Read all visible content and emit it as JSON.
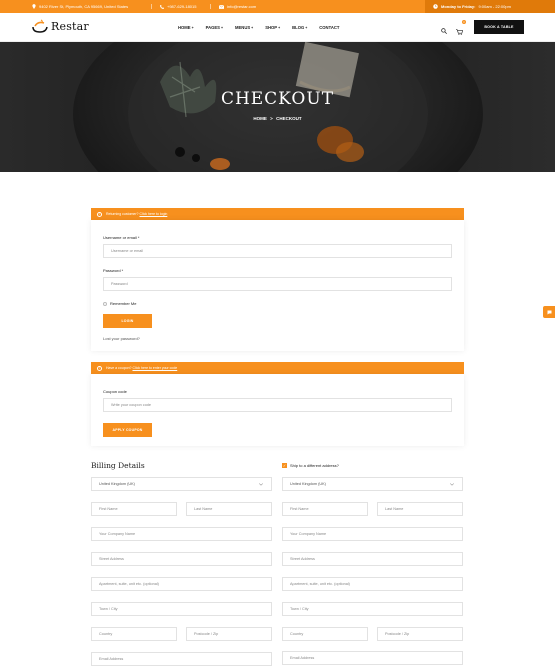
{
  "topbar": {
    "address": "9402 River St, Plymouth, CA 95669, United States",
    "phone": "+987-629-18015",
    "email": "info@restar.com",
    "hours_label": "Monday to Friday:",
    "hours_value": "9:00am - 22:00pm"
  },
  "header": {
    "logo_text": "Restar",
    "nav": [
      {
        "label": "HOME",
        "caret": "+"
      },
      {
        "label": "PAGES",
        "caret": "+"
      },
      {
        "label": "MENUS",
        "caret": "+"
      },
      {
        "label": "SHOP",
        "caret": "+"
      },
      {
        "label": "BLOG",
        "caret": "+"
      },
      {
        "label": "CONTACT",
        "caret": ""
      }
    ],
    "cart_count": "0",
    "book_label": "BOOK A TABLE"
  },
  "hero": {
    "title": "CHECKOUT",
    "crumb_home": "HOME",
    "crumb_sep": ">",
    "crumb_current": "CHECKOUT"
  },
  "login_notice": {
    "text": "Returning customer?",
    "link": "Click here to login"
  },
  "login": {
    "username_label": "Username or email *",
    "username_placeholder": "Username or email",
    "password_label": "Password *",
    "password_placeholder": "Password",
    "remember_label": "Remember Me",
    "login_button": "LOGIN",
    "lost_password": "Lost your password?"
  },
  "coupon_notice": {
    "text": "Have a coupon?",
    "link": "Click here to enter your code"
  },
  "coupon": {
    "label": "Coupon code",
    "placeholder": "Write your coupon code",
    "button": "APPLY COUPON"
  },
  "billing": {
    "title": "Billing Details",
    "country": "United Kingdom (UK)",
    "first_name": "First Name",
    "last_name": "Last Name",
    "company": "Your Company Name",
    "street": "Street Address",
    "apartment": "Apartment, suite, unit etc. (optional)",
    "town": "Town / City",
    "country_field": "Country",
    "postcode": "Postcode / Zip",
    "email": "Email Address"
  },
  "shipping": {
    "checkbox_label": "Ship to a different address?",
    "country": "United Kingdom (UK)",
    "first_name": "First Name",
    "last_name": "Last Name",
    "company": "Your Company Name",
    "street": "Street Address",
    "apartment": "Apartment, suite, unit etc. (optional)",
    "town": "Town / City",
    "country_field": "Country",
    "postcode": "Postcode / Zip",
    "email": "Email Address"
  },
  "colors": {
    "accent": "#f7901e",
    "dark": "#111111"
  }
}
